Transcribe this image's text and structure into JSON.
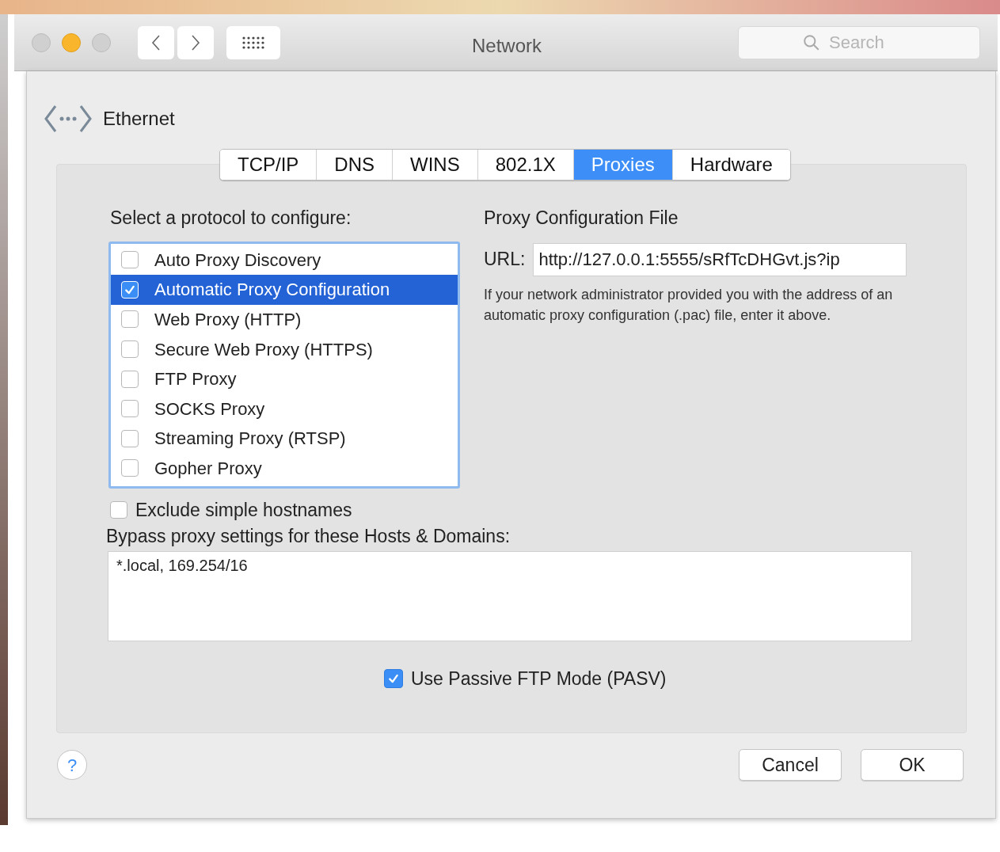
{
  "window": {
    "title": "Network"
  },
  "search": {
    "placeholder": "Search"
  },
  "service": {
    "name": "Ethernet"
  },
  "tabs": [
    {
      "label": "TCP/IP",
      "selected": false
    },
    {
      "label": "DNS",
      "selected": false
    },
    {
      "label": "WINS",
      "selected": false
    },
    {
      "label": "802.1X",
      "selected": false
    },
    {
      "label": "Proxies",
      "selected": true
    },
    {
      "label": "Hardware",
      "selected": false
    }
  ],
  "protocols": {
    "label": "Select a protocol to configure:",
    "items": [
      {
        "label": "Auto Proxy Discovery",
        "checked": false,
        "selected": false
      },
      {
        "label": "Automatic Proxy Configuration",
        "checked": true,
        "selected": true
      },
      {
        "label": "Web Proxy (HTTP)",
        "checked": false,
        "selected": false
      },
      {
        "label": "Secure Web Proxy (HTTPS)",
        "checked": false,
        "selected": false
      },
      {
        "label": "FTP Proxy",
        "checked": false,
        "selected": false
      },
      {
        "label": "SOCKS Proxy",
        "checked": false,
        "selected": false
      },
      {
        "label": "Streaming Proxy (RTSP)",
        "checked": false,
        "selected": false
      },
      {
        "label": "Gopher Proxy",
        "checked": false,
        "selected": false
      }
    ]
  },
  "exclude_simple_hostnames": {
    "label": "Exclude simple hostnames",
    "checked": false
  },
  "proxy_config": {
    "title": "Proxy Configuration File",
    "url_label": "URL:",
    "url": "http://127.0.0.1:5555/sRfTcDHGvt.js?ip",
    "help": "If your network administrator provided you with the address of an automatic proxy configuration (.pac) file, enter it above."
  },
  "bypass": {
    "label": "Bypass proxy settings for these Hosts & Domains:",
    "value": "*.local, 169.254/16"
  },
  "passive_ftp": {
    "label": "Use Passive FTP Mode (PASV)",
    "checked": true
  },
  "help_button": {
    "label": "?"
  },
  "buttons": [
    "Cancel",
    "OK"
  ]
}
